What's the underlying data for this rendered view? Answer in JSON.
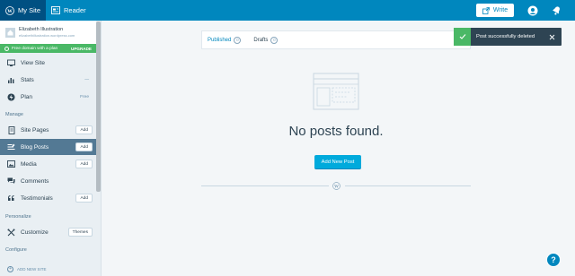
{
  "masterbar": {
    "my_site": "My Site",
    "reader": "Reader",
    "write": "Write"
  },
  "site": {
    "name": "Elizabeth Illustration",
    "domain": "elizabethillustration.wordpress.com"
  },
  "plan_nudge": {
    "text": "Free domain with a plan",
    "action": "UPGRADE"
  },
  "sidebar": {
    "view_site": "View Site",
    "stats": "Stats",
    "stats_extra": "—",
    "plan": "Plan",
    "plan_value": "Free",
    "manage_heading": "Manage",
    "site_pages": "Site Pages",
    "blog_posts": "Blog Posts",
    "media": "Media",
    "comments": "Comments",
    "testimonials": "Testimonials",
    "add_label": "Add",
    "personalize_heading": "Personalize",
    "customize": "Customize",
    "themes": "Themes",
    "configure_heading": "Configure",
    "add_new_site": "ADD NEW SITE"
  },
  "section_nav": {
    "published": "Published",
    "published_count": "0",
    "drafts": "Drafts",
    "drafts_count": "0"
  },
  "empty": {
    "title": "No posts found.",
    "action": "Add New Post"
  },
  "notice": {
    "message": "Post successfully deleted"
  },
  "help": {
    "label": "?"
  },
  "colors": {
    "masterbar": "#0087be",
    "selected": "#537994",
    "success": "#4ab866"
  }
}
